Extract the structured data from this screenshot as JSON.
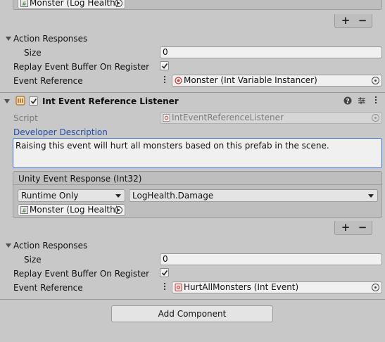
{
  "top_section": {
    "listener_object": "Monster (Log Health)",
    "action_responses_label": "Action Responses",
    "size_label": "Size",
    "size_value": "0",
    "replay_label": "Replay Event Buffer On Register",
    "replay_checked": true,
    "event_reference_label": "Event Reference",
    "event_reference_value": "Monster (Int Variable Instancer)"
  },
  "component": {
    "title": "Int Event Reference Listener",
    "enabled": true,
    "script_label": "Script",
    "script_value": "IntEventReferenceListener",
    "dev_desc_label": "Developer Description",
    "dev_desc_value": "Raising this event will hurt all monsters based on this prefab in the scene.",
    "unity_event_header": "Unity Event Response (Int32)",
    "runtime_dropdown": "Runtime Only",
    "function_dropdown": "LogHealth.Damage",
    "listener_object": "Monster (Log Health)",
    "action_responses_label": "Action Responses",
    "size_label": "Size",
    "size_value": "0",
    "replay_label": "Replay Event Buffer On Register",
    "replay_checked": true,
    "event_reference_label": "Event Reference",
    "event_reference_value": "HurtAllMonsters (Int Event)"
  },
  "add_component_label": "Add Component",
  "plus_label": "+",
  "minus_label": "−",
  "colors": {
    "background": "#c8c8c8",
    "link_blue": "#1f4fa8",
    "textarea_border": "#3a6fd8"
  }
}
